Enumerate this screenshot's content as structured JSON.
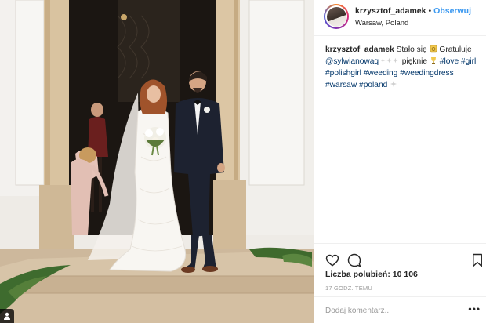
{
  "post": {
    "username": "krzysztof_adamek",
    "dot": "•",
    "follow_label": "Obserwuj",
    "location": "Warsaw, Poland"
  },
  "caption": {
    "username": "krzysztof_adamek",
    "text1": "Stało się",
    "text2": "Gratuluje",
    "mention": "@sylwianowaq",
    "text3": "pięknie",
    "hashtags": [
      "#love",
      "#girl",
      "#polishgirl",
      "#weeding",
      "#weedingdress",
      "#warsaw",
      "#poland"
    ]
  },
  "stats": {
    "likes_label": "Liczba polubień:",
    "likes_count": "10 106",
    "time": "17 godz. temu"
  },
  "comment": {
    "placeholder": "Dodaj komentarz...",
    "more": "•••"
  },
  "icons": {
    "like": "heart-icon",
    "comment": "comment-icon",
    "save": "bookmark-icon",
    "tagged": "user-icon"
  },
  "colors": {
    "follow": "#3897f0",
    "hashtag": "#003569",
    "muted": "#999999",
    "divider": "#efefef"
  }
}
